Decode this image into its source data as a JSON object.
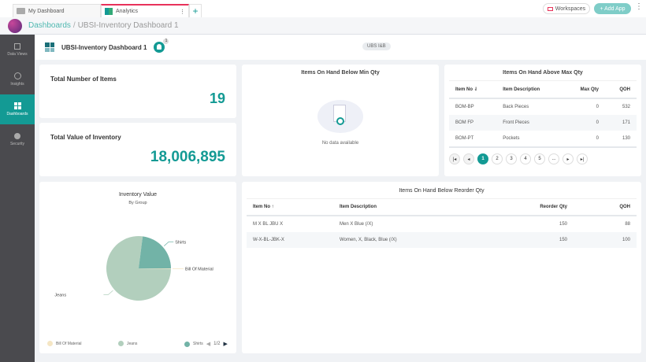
{
  "tabs": [
    {
      "label": "My Dashboard",
      "icon": "folder-icon"
    },
    {
      "label": "Analytics",
      "icon": "analytics-icon",
      "active": true
    }
  ],
  "topbar": {
    "workspaces": "Workspaces",
    "add_app": "+ Add App"
  },
  "breadcrumb": {
    "root": "Dashboards",
    "sep": "/",
    "current": "UBSI-Inventory Dashboard 1"
  },
  "sidebar": {
    "items": [
      {
        "label": "Data Views",
        "icon": "data-views-icon"
      },
      {
        "label": "Insights",
        "icon": "insights-icon"
      },
      {
        "label": "Dashboards",
        "icon": "dashboards-icon",
        "active": true
      },
      {
        "label": "Security",
        "icon": "lock-icon"
      }
    ]
  },
  "header": {
    "title": "UBSI-Inventory Dashboard 1",
    "user_count": "1",
    "badge": "UBS I&B"
  },
  "kpis": [
    {
      "label": "Total Number of Items",
      "value": "19"
    },
    {
      "label": "Total Value of Inventory",
      "value": "18,006,895"
    }
  ],
  "below_min": {
    "title": "Items On Hand Below Min Qty",
    "empty": "No data available"
  },
  "above_max": {
    "title": "Items On Hand Above Max Qty",
    "columns": [
      "Item No ⇃",
      "Item Description",
      "Max Qty",
      "QOH"
    ],
    "rows": [
      [
        "BOM-BP",
        "Back Pieces",
        "0",
        "532"
      ],
      [
        "BOM FP",
        "Front Pieces",
        "0",
        "171"
      ],
      [
        "BOM-PT",
        "Pockets",
        "0",
        "130"
      ]
    ],
    "pages": [
      "1",
      "2",
      "3",
      "4",
      "5",
      "..."
    ],
    "current_page": "1"
  },
  "reorder": {
    "title": "Items On Hand Below Reorder Qty",
    "columns": [
      "Item No ↑",
      "Item Description",
      "Reorder Qty",
      "QOH"
    ],
    "rows": [
      [
        "M X BL JBU X",
        "Men X Blue (/X)",
        "150",
        "88"
      ],
      [
        "W-X-BL-JBK-X",
        "Women, X, Black, Blue (/X)",
        "150",
        "100"
      ]
    ]
  },
  "chart_data": {
    "type": "pie",
    "title": "Inventory Value",
    "subtitle": "By Group",
    "slices": [
      {
        "name": "Bill Of Material",
        "value": 0.3,
        "color": "#f5e6c4"
      },
      {
        "name": "Jeans",
        "value": 76.7,
        "color": "#b2cfbd"
      },
      {
        "name": "Shirts",
        "value": 23,
        "color": "#72b3a7"
      }
    ],
    "unit": "percent (estimated)",
    "legend": "bottom",
    "legend_page": "1/2"
  },
  "colors": {
    "accent": "#139a94",
    "sidebar": "#4a4a4e",
    "tab_active": "#e8325a"
  }
}
